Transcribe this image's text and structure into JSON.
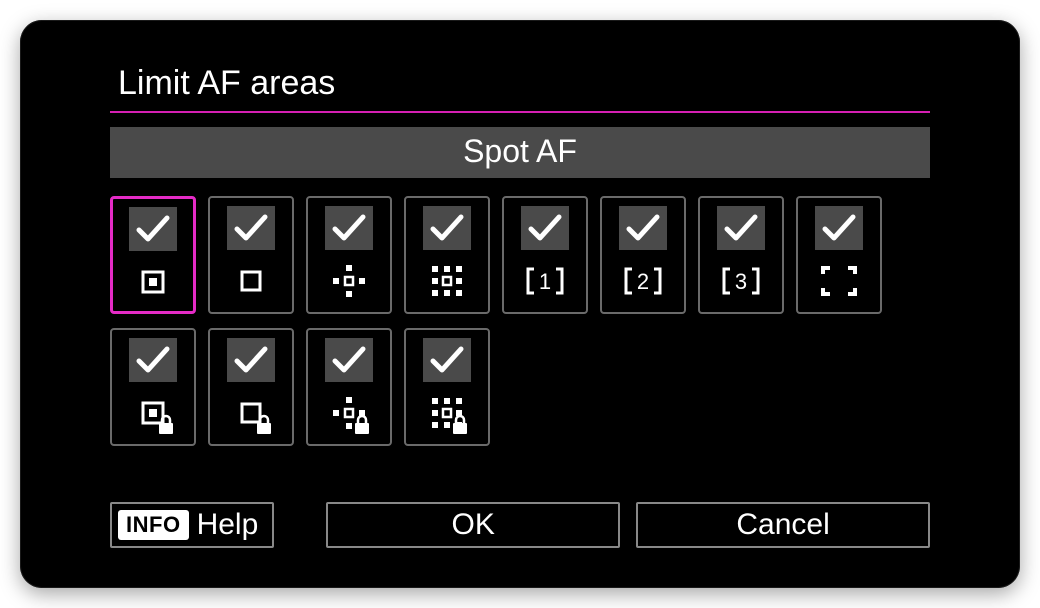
{
  "title": "Limit AF areas",
  "current_mode_label": "Spot AF",
  "accent_color": "#e52bc6",
  "tiles_row1": [
    {
      "id": "spot-af",
      "checked": true,
      "selected": true,
      "locked": false,
      "icon": "spot"
    },
    {
      "id": "1pt-af",
      "checked": true,
      "selected": false,
      "locked": false,
      "icon": "single"
    },
    {
      "id": "expand-cross",
      "checked": true,
      "selected": false,
      "locked": false,
      "icon": "cross"
    },
    {
      "id": "expand-around",
      "checked": true,
      "selected": false,
      "locked": false,
      "icon": "around"
    },
    {
      "id": "flexible-zone-1",
      "checked": true,
      "selected": false,
      "locked": false,
      "icon": "zone1"
    },
    {
      "id": "flexible-zone-2",
      "checked": true,
      "selected": false,
      "locked": false,
      "icon": "zone2"
    },
    {
      "id": "flexible-zone-3",
      "checked": true,
      "selected": false,
      "locked": false,
      "icon": "zone3"
    },
    {
      "id": "whole-area",
      "checked": true,
      "selected": false,
      "locked": false,
      "icon": "whole"
    }
  ],
  "tiles_row2": [
    {
      "id": "spot-af-lock",
      "checked": true,
      "selected": false,
      "locked": true,
      "icon": "spot"
    },
    {
      "id": "1pt-af-lock",
      "checked": true,
      "selected": false,
      "locked": true,
      "icon": "single"
    },
    {
      "id": "expand-cross-lock",
      "checked": true,
      "selected": false,
      "locked": true,
      "icon": "cross"
    },
    {
      "id": "expand-around-lock",
      "checked": true,
      "selected": false,
      "locked": true,
      "icon": "around"
    }
  ],
  "footer": {
    "info_badge": "INFO",
    "help_label": "Help",
    "ok_label": "OK",
    "cancel_label": "Cancel"
  }
}
